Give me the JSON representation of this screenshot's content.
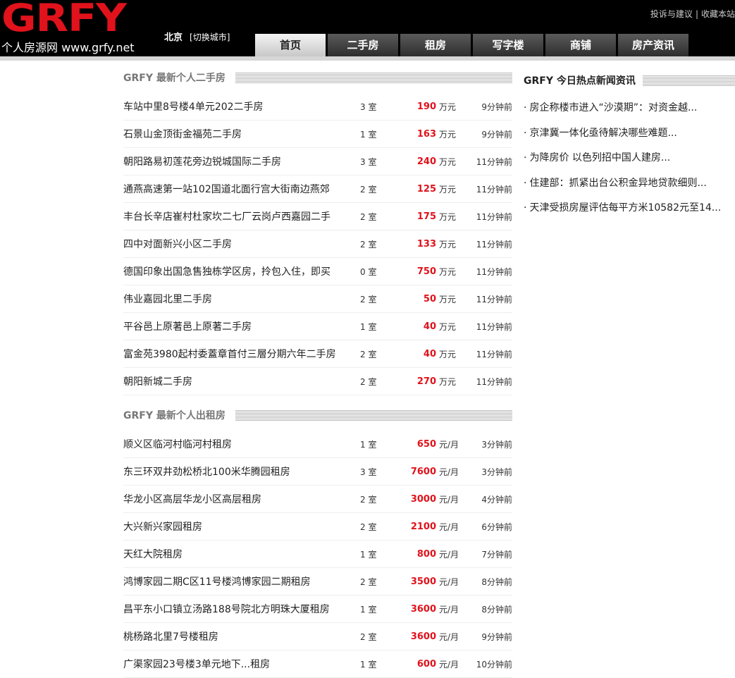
{
  "header": {
    "logo_word": "GRFY",
    "logo_sub": "个人房源网 www.grfy.net",
    "city": "北京",
    "city_switch": "[切换城市]",
    "links": [
      "投诉与建议",
      "收藏本站"
    ],
    "link_sep": "|"
  },
  "nav": {
    "tabs": [
      {
        "label": "首页",
        "active": true
      },
      {
        "label": "二手房",
        "active": false
      },
      {
        "label": "租房",
        "active": false
      },
      {
        "label": "写字楼",
        "active": false
      },
      {
        "label": "商铺",
        "active": false
      },
      {
        "label": "房产资讯",
        "active": false
      }
    ]
  },
  "sale": {
    "title": "GRFY 最新个人二手房",
    "unit": "万元",
    "items": [
      {
        "title": "车站中里8号楼4单元202二手房",
        "rooms": "3 室",
        "price": "190",
        "time": "9分钟前"
      },
      {
        "title": "石景山金顶街金福苑二手房",
        "rooms": "1 室",
        "price": "163",
        "time": "9分钟前"
      },
      {
        "title": "朝阳路易初莲花旁边锐城国际二手房",
        "rooms": "3 室",
        "price": "240",
        "time": "11分钟前"
      },
      {
        "title": "通燕高速第一站102国道北面行宫大街南边燕郊",
        "rooms": "2 室",
        "price": "125",
        "time": "11分钟前"
      },
      {
        "title": "丰台长辛店崔村杜家坎二七厂云岗卢西嘉园二手",
        "rooms": "2 室",
        "price": "175",
        "time": "11分钟前"
      },
      {
        "title": "四中对面新兴小区二手房",
        "rooms": "2 室",
        "price": "133",
        "time": "11分钟前"
      },
      {
        "title": "德国印象出国急售独栋学区房，拎包入住，即买",
        "rooms": "0 室",
        "price": "750",
        "time": "11分钟前"
      },
      {
        "title": "伟业嘉园北里二手房",
        "rooms": "2 室",
        "price": "50",
        "time": "11分钟前"
      },
      {
        "title": "平谷邑上原著邑上原著二手房",
        "rooms": "1 室",
        "price": "40",
        "time": "11分钟前"
      },
      {
        "title": "富金苑3980起村委蓋章首付三層分期六年二手房",
        "rooms": "2 室",
        "price": "40",
        "time": "11分钟前"
      },
      {
        "title": "朝阳新城二手房",
        "rooms": "2 室",
        "price": "270",
        "time": "11分钟前"
      }
    ]
  },
  "rent": {
    "title": "GRFY 最新个人出租房",
    "unit": "元/月",
    "items": [
      {
        "title": "顺义区临河村临河村租房",
        "rooms": "1 室",
        "price": "650",
        "time": "3分钟前"
      },
      {
        "title": "东三环双井劲松桥北100米华腾园租房",
        "rooms": "3 室",
        "price": "7600",
        "time": "3分钟前"
      },
      {
        "title": "华龙小区高层华龙小区高层租房",
        "rooms": "2 室",
        "price": "3000",
        "time": "4分钟前"
      },
      {
        "title": "大兴新兴家园租房",
        "rooms": "2 室",
        "price": "2100",
        "time": "6分钟前"
      },
      {
        "title": "天红大院租房",
        "rooms": "1 室",
        "price": "800",
        "time": "7分钟前"
      },
      {
        "title": "鸿博家园二期C区11号楼鸿博家园二期租房",
        "rooms": "2 室",
        "price": "3500",
        "time": "8分钟前"
      },
      {
        "title": "昌平东小口镇立汤路188号院北方明珠大厦租房",
        "rooms": "1 室",
        "price": "3600",
        "time": "8分钟前"
      },
      {
        "title": "桃杨路北里7号楼租房",
        "rooms": "2 室",
        "price": "3600",
        "time": "9分钟前"
      },
      {
        "title": "广渠家园23号楼3单元地下...租房",
        "rooms": "1 室",
        "price": "600",
        "time": "10分钟前"
      }
    ]
  },
  "news": {
    "title": "GRFY 今日热点新闻资讯",
    "bullet": "·",
    "items": [
      "房企称楼市进入“沙漠期”：对资金越...",
      "京津冀一体化亟待解决哪些难题...",
      "为降房价 以色列招中国人建房...",
      "住建部：抓紧出台公积金异地贷款细则...",
      "天津受损房屋评估每平方米10582元至14..."
    ]
  },
  "colors": {
    "brand_red": "#e0121b",
    "header_bg": "#000000",
    "tab_dark": "#3a3a3a",
    "tab_active": "#dcdcdc"
  }
}
